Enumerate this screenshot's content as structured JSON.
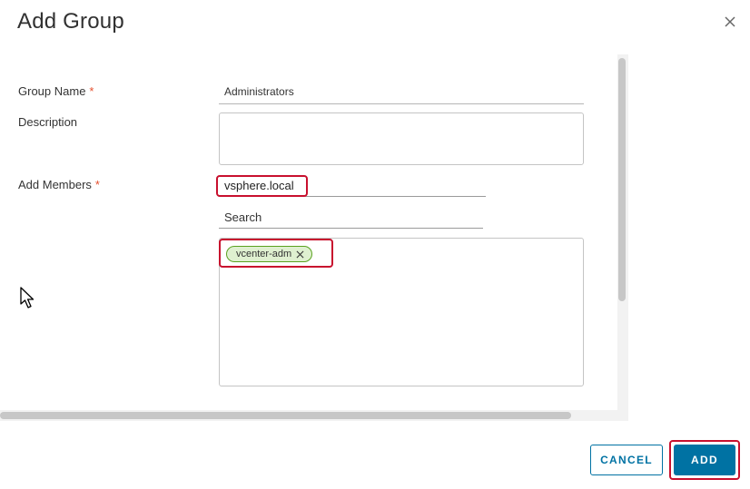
{
  "dialog": {
    "title": "Add Group",
    "close_icon": "close-icon"
  },
  "form": {
    "group_name": {
      "label": "Group Name",
      "required_marker": "*",
      "value": "Administrators"
    },
    "description": {
      "label": "Description",
      "value": ""
    },
    "add_members": {
      "label": "Add Members",
      "required_marker": "*",
      "domain": "vsphere.local",
      "search_placeholder": "Search",
      "members": [
        {
          "label": "vcenter-adm",
          "remove_icon": "close-icon"
        }
      ]
    }
  },
  "footer": {
    "cancel_label": "CANCEL",
    "add_label": "ADD"
  },
  "colors": {
    "primary": "#0072a3",
    "required": "#e5502e",
    "highlight": "#c8102e",
    "chip_fill": "#dff0d0",
    "chip_border": "#5aa220"
  }
}
